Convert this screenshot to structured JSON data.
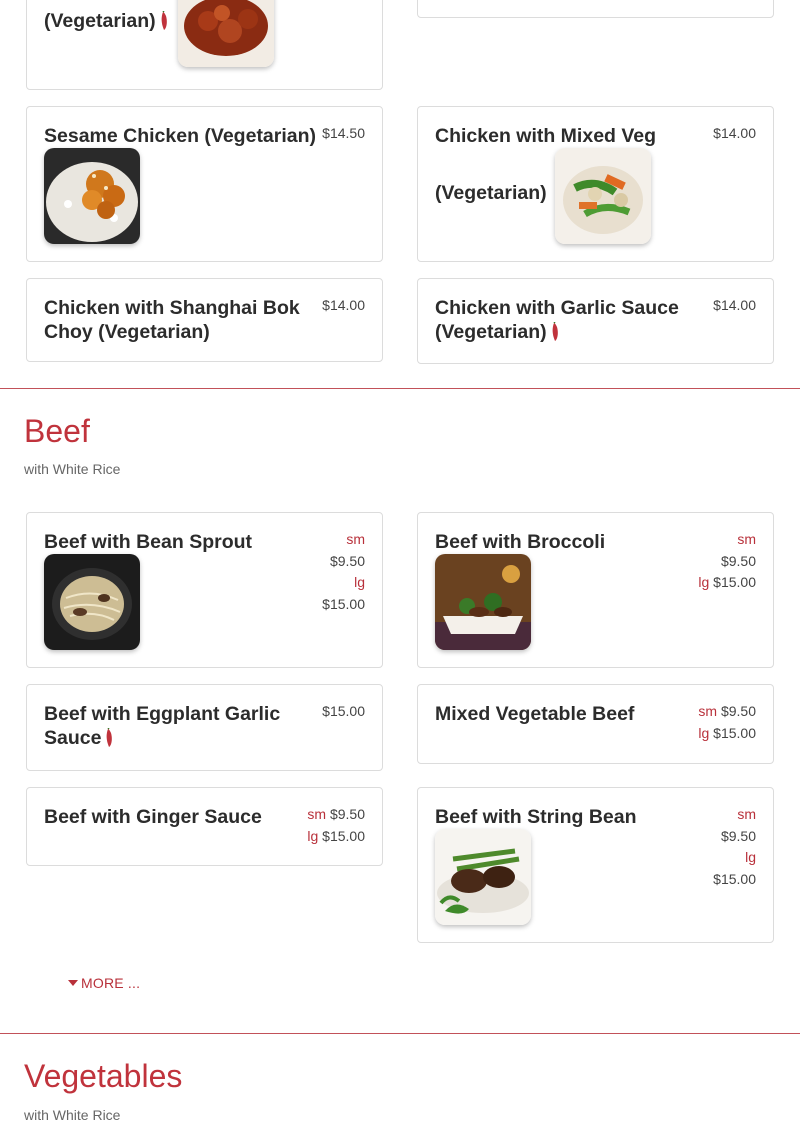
{
  "chicken": {
    "top_left": {
      "name": "(Vegetarian)",
      "spicy": true
    },
    "sesame": {
      "name": "Sesame Chicken (Vegetarian)",
      "price": "$14.50",
      "image": "sesame-chicken-photo"
    },
    "mixed_veg": {
      "name_line1": "Chicken with Mixed Veg",
      "name_line2": "(Vegetarian)",
      "price": "$14.00",
      "image": "mixed-veg-chicken-photo"
    },
    "bok_choy": {
      "name_line1": "Chicken with Shanghai Bok",
      "name_line2": "Choy (Vegetarian)",
      "price": "$14.00"
    },
    "garlic": {
      "name_line1": "Chicken with Garlic Sauce",
      "name_line2": "(Vegetarian)",
      "price": "$14.00",
      "spicy": true
    }
  },
  "beef_section": {
    "title": "Beef",
    "subtitle": "with White Rice",
    "items": {
      "bean_sprout": {
        "name": "Beef with Bean Sprout",
        "sm_label": "sm",
        "sm_price": "$9.50",
        "lg_label": "lg",
        "lg_price": "$15.00",
        "image": "beef-bean-sprout-photo"
      },
      "broccoli": {
        "name": "Beef with Broccoli",
        "sm_label": "sm",
        "sm_price": "$9.50",
        "lg_label": "lg",
        "lg_price": "$15.00",
        "image": "beef-broccoli-photo"
      },
      "eggplant": {
        "name_line1": "Beef with Eggplant Garlic",
        "name_line2": "Sauce",
        "price": "$15.00",
        "spicy": true
      },
      "mixed_veg": {
        "name": "Mixed Vegetable Beef",
        "sm_label": "sm",
        "sm_price": "$9.50",
        "lg_label": "lg",
        "lg_price": "$15.00"
      },
      "ginger": {
        "name": "Beef with Ginger Sauce",
        "sm_label": "sm",
        "sm_price": "$9.50",
        "lg_label": "lg",
        "lg_price": "$15.00"
      },
      "string_bean": {
        "name": "Beef with String Bean",
        "sm_label": "sm",
        "sm_price": "$9.50",
        "lg_label": "lg",
        "lg_price": "$15.00",
        "image": "beef-string-bean-photo"
      }
    },
    "more_label": "MORE ..."
  },
  "vegetables_section": {
    "title": "Vegetables",
    "subtitle": "with White Rice"
  },
  "colors": {
    "accent": "#c0333c",
    "text": "#2c2c2c",
    "border": "#dcdcdc"
  }
}
